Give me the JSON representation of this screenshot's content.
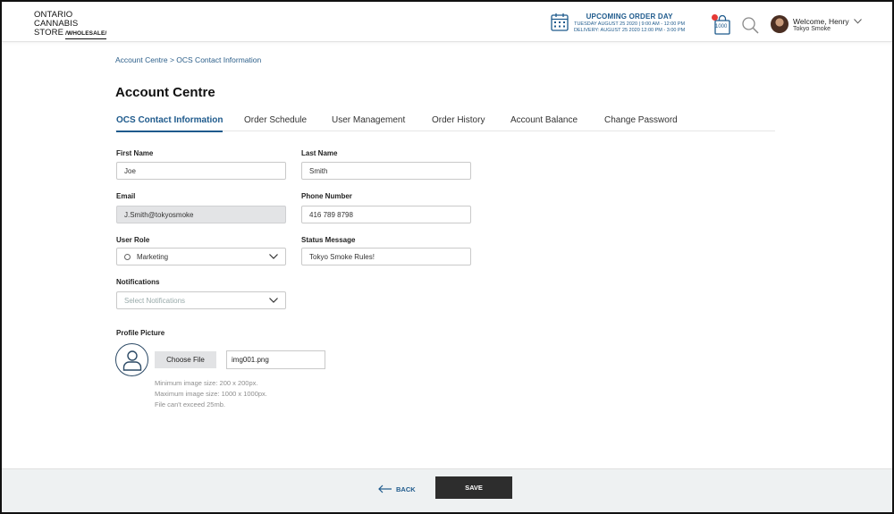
{
  "header": {
    "logo": {
      "line1": "ONTARIO",
      "line2": "CANNABIS",
      "line3": "STORE",
      "line3_sub": "/WHOLESALE/"
    },
    "order": {
      "title": "UPCOMING ORDER DAY",
      "line1": "TUESDAY AUGUST 25 2020 | 9:00 AM - 12:00 PM",
      "line2": "DELIVERY: AUGUST 25 2020 12:00 PM - 3:00 PM"
    },
    "cart_count": "1000",
    "user": {
      "welcome": "Welcome, Henry",
      "company": "Tokyo Smoke"
    }
  },
  "breadcrumb": "Account Centre > OCS Contact Information",
  "page_title": "Account Centre",
  "tabs": [
    {
      "label": "OCS Contact Information"
    },
    {
      "label": "Order Schedule"
    },
    {
      "label": "User Management"
    },
    {
      "label": "Order History"
    },
    {
      "label": "Account Balance"
    },
    {
      "label": "Change Password"
    }
  ],
  "form": {
    "first_name": {
      "label": "First Name",
      "value": "Joe"
    },
    "last_name": {
      "label": "Last Name",
      "value": "Smith"
    },
    "email": {
      "label": "Email",
      "value": "J.Smith@tokyosmoke"
    },
    "phone": {
      "label": "Phone Number",
      "value": "416 789 8798"
    },
    "user_role": {
      "label": "User Role",
      "value": "Marketing"
    },
    "status_message": {
      "label": "Status Message",
      "value": "Tokyo Smoke Rules!"
    },
    "notifications": {
      "label": "Notifications",
      "placeholder": "Select Notifications"
    },
    "profile_picture": {
      "label": "Profile Picture",
      "choose_file": "Choose File",
      "file_name": "img001.png",
      "hints": [
        "Minimum image size: 200 x 200px.",
        "Maximum image size: 1000 x 1000px.",
        "File can't exceed 25mb."
      ]
    }
  },
  "footer": {
    "back": "BACK",
    "save": "SAVE"
  },
  "colors": {
    "accent": "#1e5a8c",
    "notification_dot": "#e53935",
    "save_button": "#2d2d2d"
  }
}
